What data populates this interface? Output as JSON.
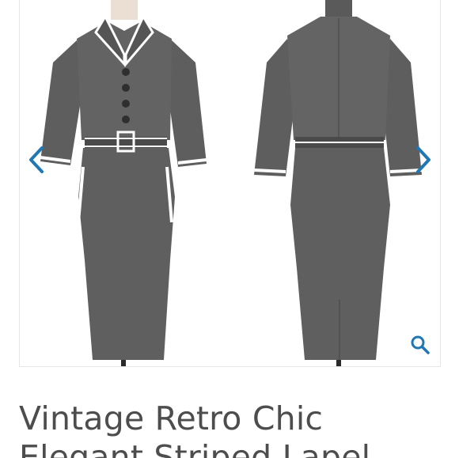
{
  "gallery": {
    "image_alt": "Vintage Retro Chic Elegant Striped Lapel dress, front and back views",
    "prev_icon": "chevron-left-icon",
    "next_icon": "chevron-right-icon",
    "zoom_icon": "magnifier-icon",
    "accent_color": "#1f77b4",
    "dress_color": "#5c5c5c"
  },
  "product": {
    "title": "Vintage Retro Chic Elegant Striped Lapel"
  }
}
